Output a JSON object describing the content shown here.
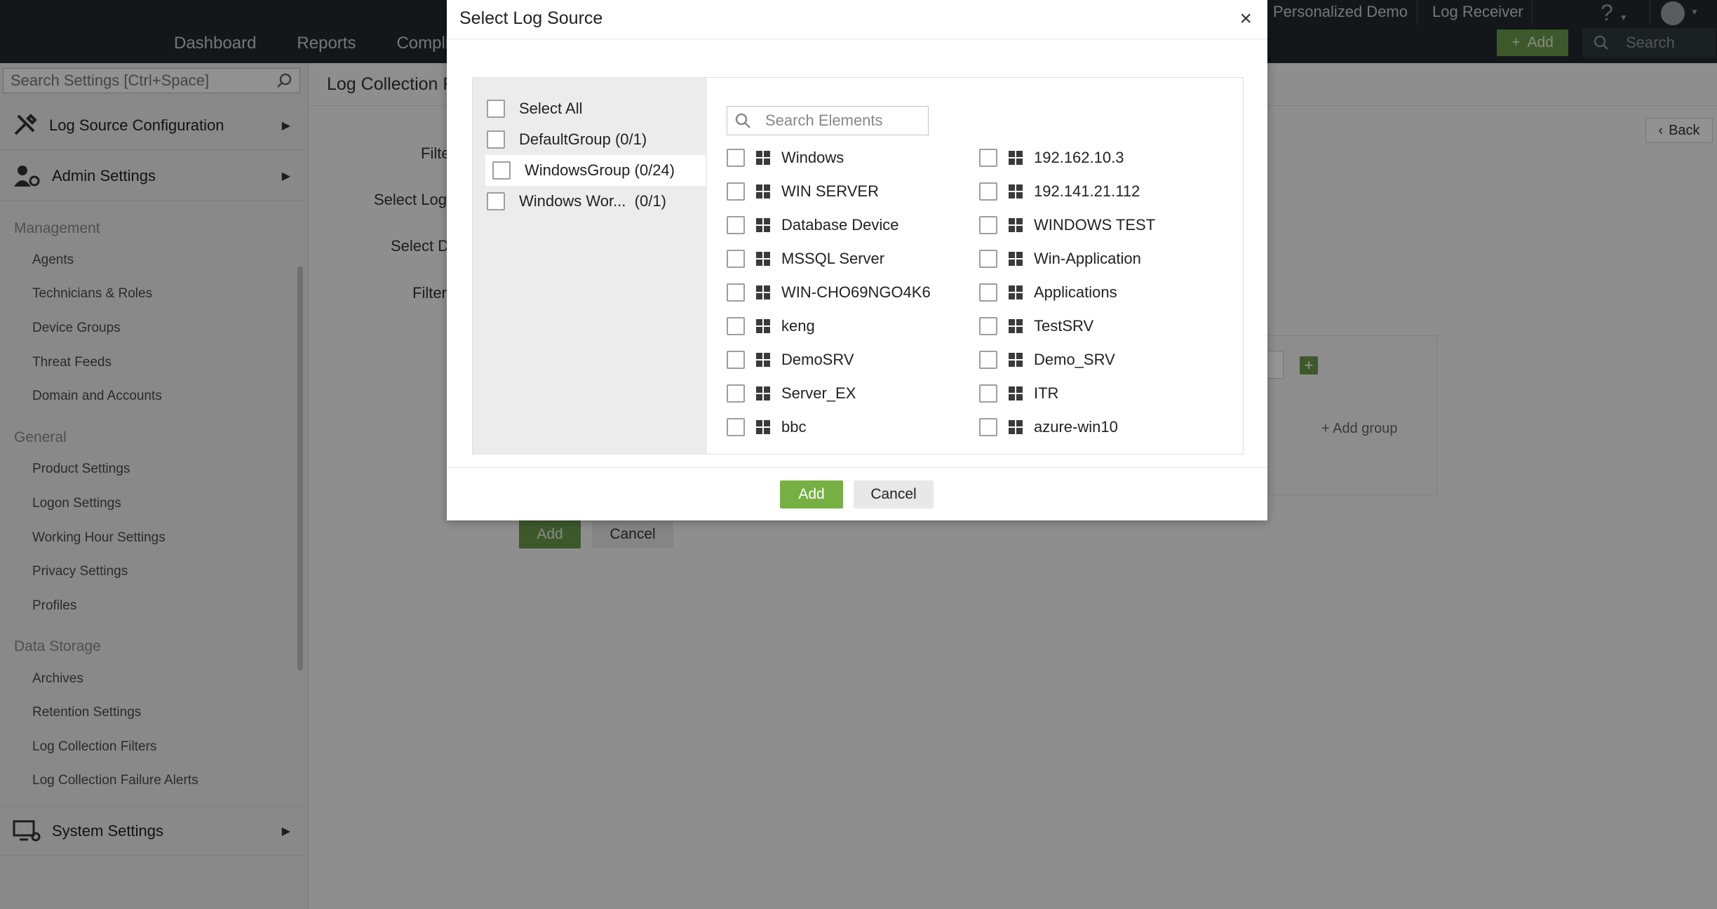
{
  "topbar": {
    "nav": [
      "Dashboard",
      "Reports",
      "Compli"
    ],
    "links": [
      "Personalized Demo",
      "Log Receiver"
    ],
    "add_label": "Add",
    "search_placeholder": "Search",
    "help_label": "?"
  },
  "sidebar": {
    "search_placeholder": "Search Settings [Ctrl+Space]",
    "sections": {
      "log_source": "Log Source Configuration",
      "admin": "Admin Settings",
      "system": "System Settings"
    },
    "groups": [
      {
        "title": "Management",
        "items": [
          "Agents",
          "Technicians & Roles",
          "Device Groups",
          "Threat Feeds",
          "Domain and Accounts"
        ]
      },
      {
        "title": "General",
        "items": [
          "Product Settings",
          "Logon Settings",
          "Working Hour Settings",
          "Privacy Settings",
          "Profiles"
        ]
      },
      {
        "title": "Data Storage",
        "items": [
          "Archives",
          "Retention Settings",
          "Log Collection Filters",
          "Log Collection Failure Alerts"
        ]
      }
    ]
  },
  "page": {
    "title": "Log Collection F",
    "labels": [
      "Filte",
      "Select Log",
      "Select D",
      "Filter"
    ],
    "back_label": "Back",
    "add_group": "Add group",
    "add_label": "Add",
    "cancel_label": "Cancel"
  },
  "modal": {
    "title": "Select Log Source",
    "close": "×",
    "groups": [
      {
        "label": "Select All",
        "count": ""
      },
      {
        "label": "DefaultGroup",
        "count": "(0/1)"
      },
      {
        "label": "WindowsGroup",
        "count": "(0/24)"
      },
      {
        "label": "Windows Wor...",
        "count": "(0/1)"
      }
    ],
    "search_placeholder": "Search Elements",
    "elements_col1": [
      "Windows",
      "WIN SERVER",
      "Database Device",
      "MSSQL Server",
      "WIN-CHO69NGO4K6",
      "keng",
      "DemoSRV",
      "Server_EX",
      "bbc"
    ],
    "elements_col2": [
      "192.162.10.3",
      "192.141.21.112",
      "WINDOWS TEST",
      "Win-Application",
      "Applications",
      "TestSRV",
      "Demo_SRV",
      "ITR",
      "azure-win10"
    ],
    "add_label": "Add",
    "cancel_label": "Cancel"
  },
  "colors": {
    "accent_green": "#76b043",
    "topbar": "#22292e"
  }
}
